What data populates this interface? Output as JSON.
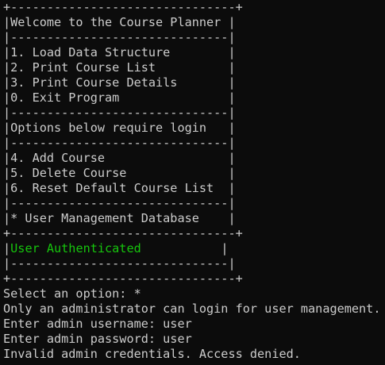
{
  "menu": {
    "border_top": "+-------------------------------+",
    "title_line": "|Welcome to the Course Planner |",
    "separator": "|------------------------------|",
    "items": [
      "|1. Load Data Structure        |",
      "|2. Print Course List          |",
      "|3. Print Course Details       |",
      "|0. Exit Program               |"
    ],
    "login_note": "|Options below require login   |",
    "admin_items": [
      "|4. Add Course                 |",
      "|5. Delete Course              |",
      "|6. Reset Default Course List  |"
    ],
    "user_mgmt": "|* User Management Database    |",
    "mid_border": "+-------------------------------+",
    "auth_left": "|",
    "auth_status": "User Authenticated",
    "auth_right": "           |",
    "bottom_border": "+-------------------------------+"
  },
  "output": {
    "prompt": "Select an option: *",
    "line1": "Only an administrator can login for user management.",
    "line2": "Enter admin username: user",
    "line3": "Enter admin password: user",
    "line4": "Invalid admin credentials. Access denied."
  },
  "colors": {
    "background": "#0c0c0c",
    "text": "#cccccc",
    "status": "#16c60c"
  }
}
